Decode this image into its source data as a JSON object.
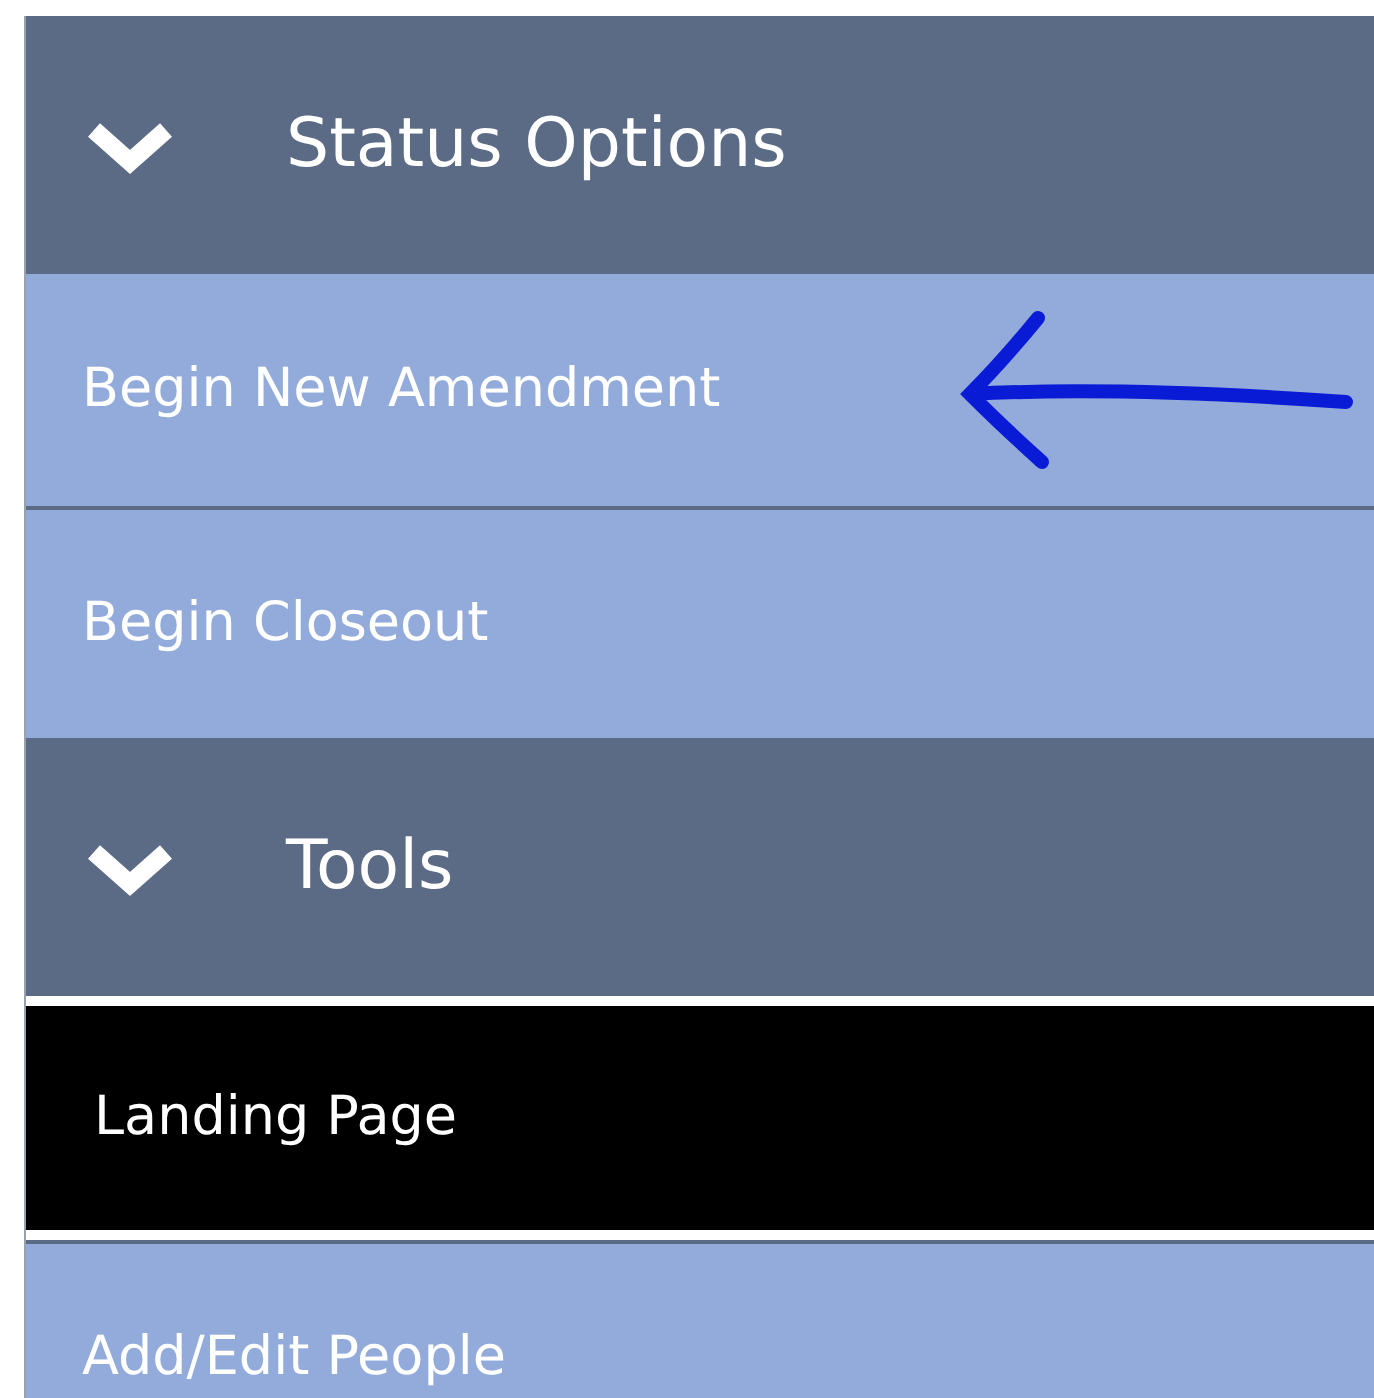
{
  "sections": [
    {
      "title": "Status Options",
      "expanded": true,
      "items": [
        {
          "label": "Begin New Amendment",
          "selected": false,
          "annotated": true
        },
        {
          "label": "Begin Closeout",
          "selected": false,
          "annotated": false
        }
      ]
    },
    {
      "title": "Tools",
      "expanded": true,
      "items": [
        {
          "label": "Landing Page",
          "selected": true,
          "annotated": false
        },
        {
          "label": "Add/Edit People",
          "selected": false,
          "annotated": false
        }
      ]
    }
  ]
}
